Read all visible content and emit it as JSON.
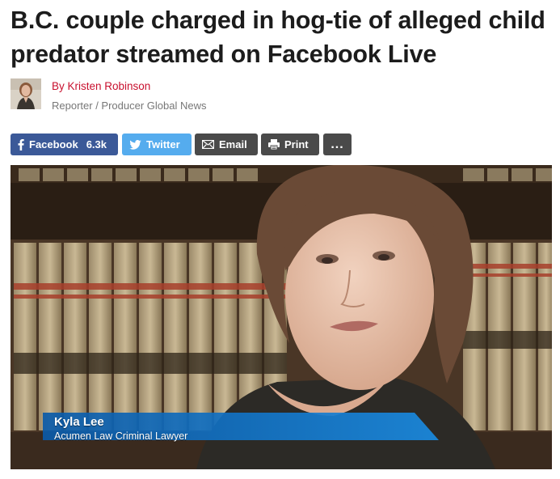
{
  "article": {
    "headline": "B.C. couple charged in hog-tie of alleged child predator streamed on Facebook Live"
  },
  "byline": {
    "author": "By Kristen Robinson",
    "role": "Reporter / Producer  Global News"
  },
  "share": {
    "facebook_label": "Facebook",
    "facebook_count": "6.3k",
    "twitter_label": "Twitter",
    "email_label": "Email",
    "print_label": "Print",
    "more_label": "..."
  },
  "video": {
    "lower_third_name": "Kyla Lee",
    "lower_third_title": "Acumen Law Criminal Lawyer"
  },
  "colors": {
    "facebook": "#3b5998",
    "twitter": "#55acee",
    "dark_button": "#4a4a4a",
    "author_link": "#c8102e",
    "lower_third_blue": "#0a6cc0"
  },
  "icons": [
    "facebook-icon",
    "twitter-icon",
    "email-icon",
    "print-icon"
  ]
}
